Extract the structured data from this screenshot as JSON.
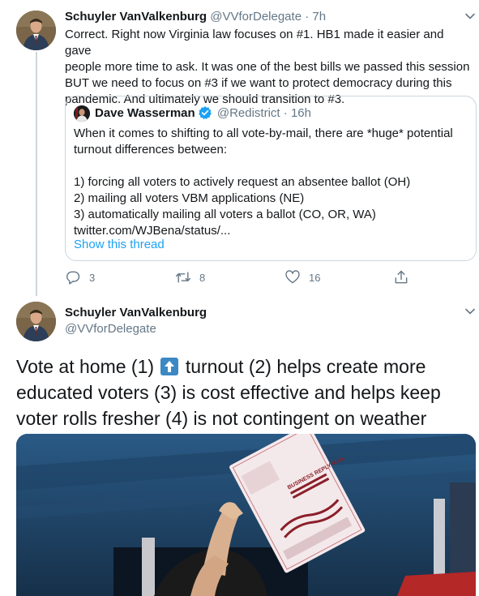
{
  "tweet1": {
    "author_name": "Schuyler VanValkenburg",
    "author_handle": "@VVforDelegate",
    "separator": "·",
    "time": "7h",
    "text": "Correct. Right now Virginia law focuses on #1. HB1 made it easier and gave\npeople more time to ask. It was one of the best bills we passed this session\nBUT we need to focus on #3 if we want to protect democracy during this\npandemic. And ultimately we should transition to #3.",
    "quote": {
      "author_name": "Dave Wasserman",
      "author_handle": "@Redistrict",
      "separator": "·",
      "time": "16h",
      "text": "When it comes to shifting to all vote-by-mail, there are *huge* potential\nturnout differences between:\n\n1) forcing all voters to actively request an absentee ballot (OH)\n2) mailing all voters VBM applications (NE)\n3) automatically mailing all voters a ballot (CO, OR, WA)\ntwitter.com/WJBena/status/...",
      "show_thread": "Show this thread"
    },
    "actions": {
      "reply_count": "3",
      "retweet_count": "8",
      "like_count": "16"
    }
  },
  "tweet2": {
    "author_name": "Schuyler VanValkenburg",
    "author_handle": "@VVforDelegate",
    "text_before_emoji": "Vote at home (1) ",
    "emoji": "up-arrow-emoji",
    "text_after_emoji": " turnout (2) helps create more educated voters (3) is cost effective and helps keep voter rolls fresher (4) is not contingent on weather",
    "photo": "photo-voter-holding-mail-ballot"
  },
  "colors": {
    "text": "#14171a",
    "secondary": "#657786",
    "link": "#1da1f2",
    "border": "#ccd6dd",
    "verified": "#1da1f2"
  }
}
